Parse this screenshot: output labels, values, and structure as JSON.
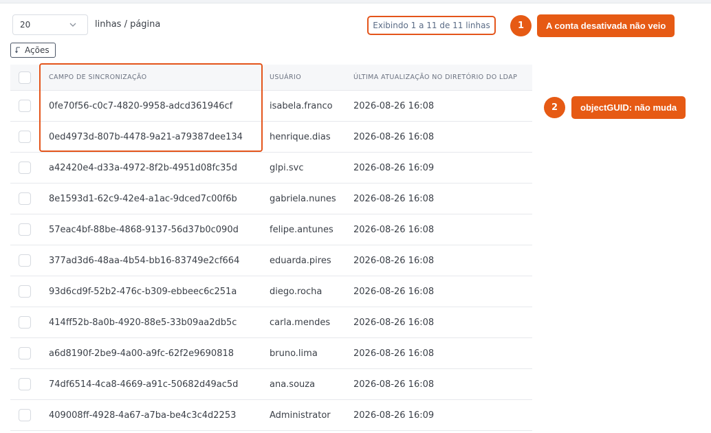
{
  "pagination": {
    "per_page_value": "20",
    "per_page_label": "linhas / página",
    "showing_text": "Exibindo 1 a 11 de 11 linhas"
  },
  "actions_label": "Ações",
  "annotations": [
    {
      "number": "1",
      "text": "A conta desativada não veio"
    },
    {
      "number": "2",
      "text": "objectGUID: não muda"
    }
  ],
  "table": {
    "columns": [
      "CAMPO DE SINCRONIZAÇÃO",
      "USUÁRIO",
      "ÚLTIMA ATUALIZAÇÃO NO DIRETÓRIO DO LDAP"
    ],
    "rows": [
      {
        "guid": "0fe70f56-c0c7-4820-9958-adcd361946cf",
        "user": "isabela.franco",
        "updated": "2026-08-26 16:08"
      },
      {
        "guid": "0ed4973d-807b-4478-9a21-a79387dee134",
        "user": "henrique.dias",
        "updated": "2026-08-26 16:08"
      },
      {
        "guid": "a42420e4-d33a-4972-8f2b-4951d08fc35d",
        "user": "glpi.svc",
        "updated": "2026-08-26 16:09"
      },
      {
        "guid": "8e1593d1-62c9-42e4-a1ac-9dced7c00f6b",
        "user": "gabriela.nunes",
        "updated": "2026-08-26 16:08"
      },
      {
        "guid": "57eac4bf-88be-4868-9137-56d37b0c090d",
        "user": "felipe.antunes",
        "updated": "2026-08-26 16:08"
      },
      {
        "guid": "377ad3d6-48aa-4b54-bb16-83749e2cf664",
        "user": "eduarda.pires",
        "updated": "2026-08-26 16:08"
      },
      {
        "guid": "93d6cd9f-52b2-476c-b309-ebbeec6c251a",
        "user": "diego.rocha",
        "updated": "2026-08-26 16:08"
      },
      {
        "guid": "414ff52b-8a0b-4920-88e5-33b09aa2db5c",
        "user": "carla.mendes",
        "updated": "2026-08-26 16:08"
      },
      {
        "guid": "a6d8190f-2be9-4a00-a9fc-62f2e9690818",
        "user": "bruno.lima",
        "updated": "2026-08-26 16:08"
      },
      {
        "guid": "74df6514-4ca8-4669-a91c-50682d49ac5d",
        "user": "ana.souza",
        "updated": "2026-08-26 16:08"
      },
      {
        "guid": "409008ff-4928-4a67-a7ba-be4c3c4d2253",
        "user": "Administrator",
        "updated": "2026-08-26 16:09"
      }
    ]
  },
  "colors": {
    "accent": "#e65a14",
    "highlight_border": "#e4541a"
  }
}
